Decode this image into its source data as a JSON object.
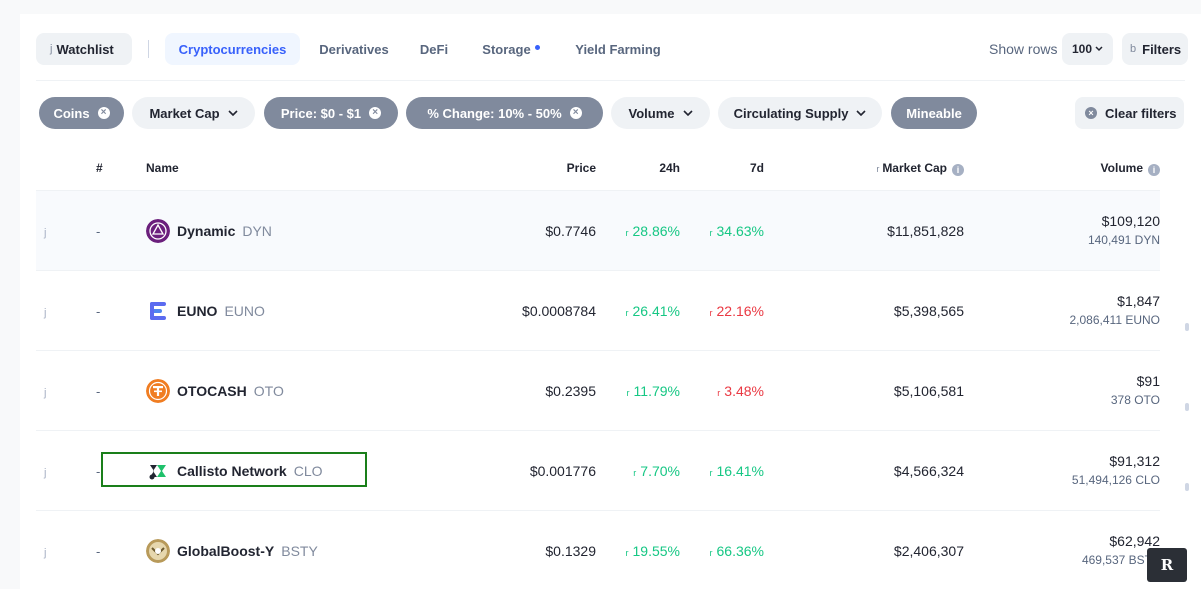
{
  "nav": {
    "watchlist_glyph": "j",
    "watchlist_label": "Watchlist",
    "tabs": [
      {
        "label": "Cryptocurrencies"
      },
      {
        "label": "Derivatives"
      },
      {
        "label": "DeFi"
      },
      {
        "label": "Storage"
      },
      {
        "label": "Yield Farming"
      }
    ],
    "show_rows_label": "Show rows",
    "rows_value": "100",
    "filters_glyph": "b",
    "filters_label": "Filters"
  },
  "filters": {
    "chips": [
      {
        "label": "Coins",
        "state": "active"
      },
      {
        "label": "Market Cap",
        "state": "dropdown"
      },
      {
        "label": "Price: $0 - $1",
        "state": "active"
      },
      {
        "label": "% Change: 10% - 50%",
        "state": "active"
      },
      {
        "label": "Volume",
        "state": "dropdown"
      },
      {
        "label": "Circulating Supply",
        "state": "dropdown"
      },
      {
        "label": "Mineable",
        "state": "active-plain"
      }
    ],
    "clear_label": "Clear filters"
  },
  "table": {
    "headers": {
      "rank": "#",
      "name": "Name",
      "price": "Price",
      "h24": "24h",
      "d7": "7d",
      "mcap_glyph": "r",
      "mcap": "Market Cap",
      "volume": "Volume"
    },
    "rows": [
      {
        "star": "j",
        "rank": "-",
        "name": "Dynamic",
        "symbol": "DYN",
        "price": "$0.7746",
        "h24": "28.86%",
        "h24_dir": "up",
        "d7": "34.63%",
        "d7_dir": "up",
        "mcap": "$11,851,828",
        "vol_usd": "$109,120",
        "vol_coin": "140,491 DYN"
      },
      {
        "star": "j",
        "rank": "-",
        "name": "EUNO",
        "symbol": "EUNO",
        "price": "$0.0008784",
        "h24": "26.41%",
        "h24_dir": "up",
        "d7": "22.16%",
        "d7_dir": "down",
        "mcap": "$5,398,565",
        "vol_usd": "$1,847",
        "vol_coin": "2,086,411 EUNO"
      },
      {
        "star": "j",
        "rank": "-",
        "name": "OTOCASH",
        "symbol": "OTO",
        "price": "$0.2395",
        "h24": "11.79%",
        "h24_dir": "up",
        "d7": "3.48%",
        "d7_dir": "down",
        "mcap": "$5,106,581",
        "vol_usd": "$91",
        "vol_coin": "378 OTO"
      },
      {
        "star": "j",
        "rank": "-",
        "name": "Callisto Network",
        "symbol": "CLO",
        "price": "$0.001776",
        "h24": "7.70%",
        "h24_dir": "up",
        "d7": "16.41%",
        "d7_dir": "up",
        "mcap": "$4,566,324",
        "vol_usd": "$91,312",
        "vol_coin": "51,494,126 CLO"
      },
      {
        "star": "j",
        "rank": "-",
        "name": "GlobalBoost-Y",
        "symbol": "BSTY",
        "price": "$0.1329",
        "h24": "19.55%",
        "h24_dir": "up",
        "d7": "66.36%",
        "d7_dir": "up",
        "mcap": "$2,406,307",
        "vol_usd": "$62,942",
        "vol_coin": "469,537 BSTY"
      }
    ]
  },
  "arrows": {
    "up": "r",
    "down": "r"
  },
  "badge": "R",
  "colors": {
    "accent": "#3861fb",
    "up": "#16c784",
    "down": "#ea3943",
    "chip_dark": "#808a9d",
    "highlight": "#1a7f1a"
  }
}
